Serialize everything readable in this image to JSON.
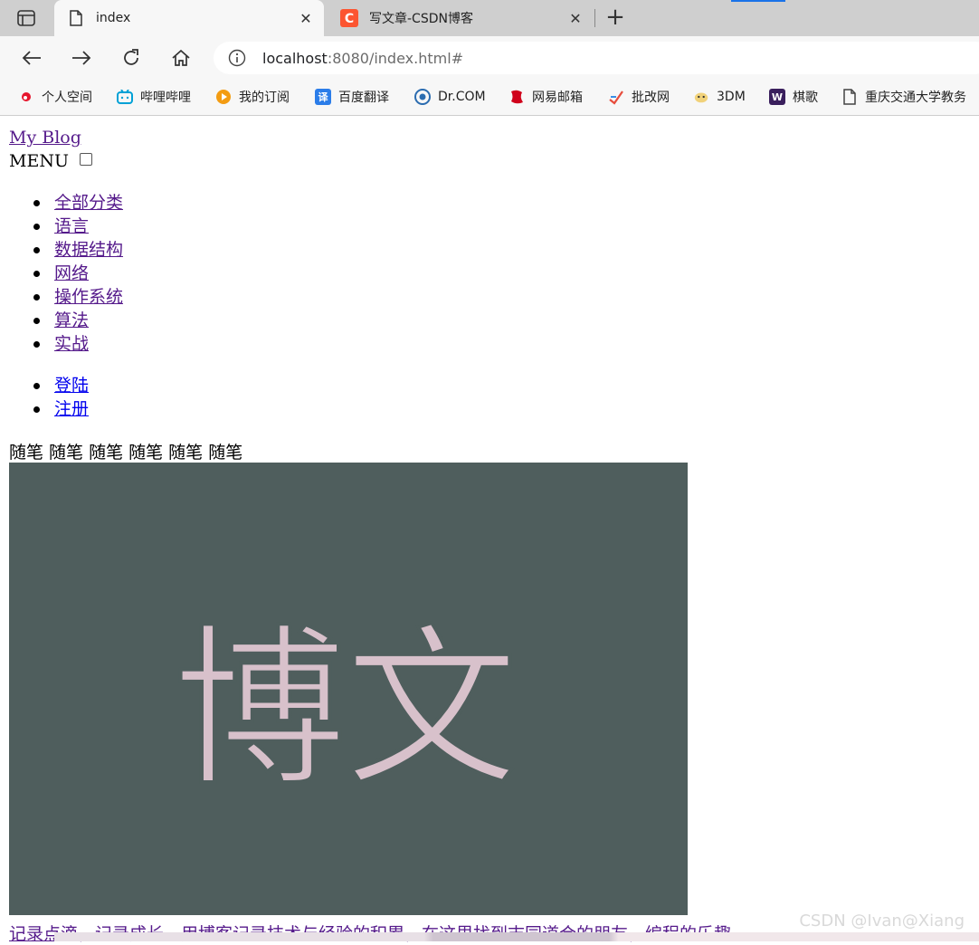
{
  "browser": {
    "tabs": [
      {
        "title": "index",
        "active": true
      },
      {
        "title": "写文章-CSDN博客",
        "active": false
      }
    ],
    "address": {
      "host": "localhost",
      "rest": ":8080/index.html#"
    },
    "bookmarks": [
      {
        "label": "个人空间",
        "icon": "weibo-icon",
        "color": "#e6162d"
      },
      {
        "label": "哔哩哔哩",
        "icon": "bilibili-icon",
        "color": "#00a1d6"
      },
      {
        "label": "我的订阅",
        "icon": "subscribe-icon",
        "color": "#f39c12"
      },
      {
        "label": "百度翻译",
        "icon": "translate-icon",
        "color": "#2b7de9",
        "glyph": "译"
      },
      {
        "label": "Dr.COM",
        "icon": "drcom-icon",
        "color": "#2b6cb0"
      },
      {
        "label": "网易邮箱",
        "icon": "netease-mail-icon",
        "color": "#d0021b"
      },
      {
        "label": "批改网",
        "icon": "pigai-icon",
        "color": "#e74c3c"
      },
      {
        "label": "3DM",
        "icon": "3dm-icon",
        "color": "#d4a017"
      },
      {
        "label": "棋歌",
        "icon": "qige-icon",
        "color": "#3a1f5d",
        "glyph": "W"
      },
      {
        "label": "重庆交通大学教务",
        "icon": "page-icon",
        "color": "#444444"
      }
    ]
  },
  "page": {
    "brand": "My Blog",
    "menu_label": "MENU",
    "categories": [
      "全部分类",
      "语言",
      "数据结构",
      "网络",
      "操作系统",
      "算法",
      "实战"
    ],
    "auth": [
      "登陆",
      "注册"
    ],
    "essays": "随笔 随笔 随笔 随笔 随笔 随笔",
    "hero_text": "博文",
    "tagline": "记录点滴，记录成长。用博客记录技术与经验的积累，在这里找到志同道合的朋友，编程的乐趣",
    "watermark": "CSDN @Ivan@Xiang"
  },
  "colors": {
    "hero_bg": "#4f5e5d",
    "hero_text": "#d8c1cb",
    "visited_link": "#551a8b",
    "unvisited_link": "#0000ee"
  }
}
